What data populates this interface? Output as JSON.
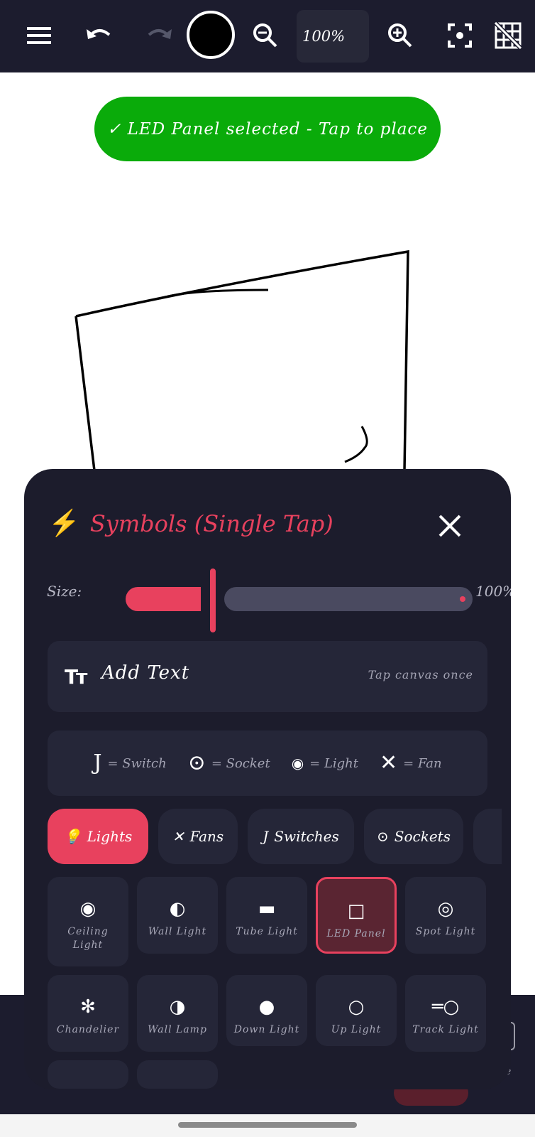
{
  "toolbar": {
    "zoom": "100%",
    "icons": [
      "menu-icon",
      "undo-icon",
      "redo-icon",
      "color-swatch",
      "zoom-out-icon",
      "zoom-in-icon",
      "fit-screen-icon",
      "grid-off-icon"
    ],
    "current_color": "#000000"
  },
  "toast": {
    "text": "✓ LED Panel selected - Tap to place"
  },
  "panel": {
    "title_icon": "⚡",
    "title": "Symbols (Single Tap)",
    "size": {
      "label": "Size:",
      "value_text": "100%",
      "value": 1.0
    },
    "add_text": {
      "icon": "Tт",
      "label": "Add Text",
      "hint": "Tap canvas once"
    },
    "legend": [
      {
        "symbol": "J",
        "text": "= Switch"
      },
      {
        "symbol": "⊙",
        "text": "= Socket"
      },
      {
        "symbol": "◉",
        "text": "= Light"
      },
      {
        "symbol": "✕",
        "text": "= Fan"
      }
    ],
    "categories": [
      {
        "icon": "💡",
        "label": "Lights",
        "active": true
      },
      {
        "icon": "✕",
        "label": "Fans",
        "active": false
      },
      {
        "icon": "J",
        "label": "Switches",
        "active": false
      },
      {
        "icon": "⊙",
        "label": "Sockets",
        "active": false
      }
    ],
    "symbols": [
      {
        "symbol": "◉",
        "label": "Ceiling Light",
        "selected": false
      },
      {
        "symbol": "◐",
        "label": "Wall Light",
        "selected": false
      },
      {
        "symbol": "▬",
        "label": "Tube Light",
        "selected": false
      },
      {
        "symbol": "□",
        "label": "LED Panel",
        "selected": true
      },
      {
        "symbol": "◎",
        "label": "Spot Light",
        "selected": false
      },
      {
        "symbol": "✻",
        "label": "Chandelier",
        "selected": false
      },
      {
        "symbol": "◑",
        "label": "Wall Lamp",
        "selected": false
      },
      {
        "symbol": "●",
        "label": "Down Light",
        "selected": false
      },
      {
        "symbol": "○",
        "label": "Up Light",
        "selected": false
      },
      {
        "symbol": "═○",
        "label": "Track Light",
        "selected": false
      }
    ]
  },
  "colors": {
    "toolbar_bg": "#1c1c2e",
    "panel_bg": "#1c1c2c",
    "accent": "#e8415e",
    "toast_bg": "#0aab0a"
  }
}
